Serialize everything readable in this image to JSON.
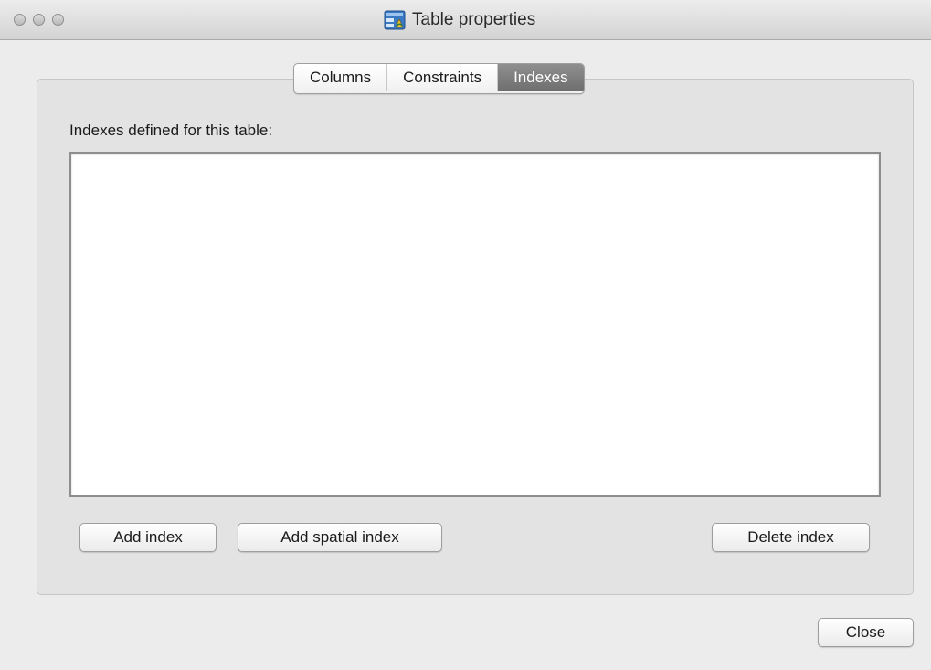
{
  "window": {
    "title": "Table properties",
    "title_icon": "database-table-icon"
  },
  "tabs": [
    {
      "label": "Columns",
      "active": false
    },
    {
      "label": "Constraints",
      "active": false
    },
    {
      "label": "Indexes",
      "active": true
    }
  ],
  "indexes_panel": {
    "label": "Indexes defined for this table:",
    "items": []
  },
  "buttons": {
    "add_index": "Add index",
    "add_spatial_index": "Add spatial index",
    "delete_index": "Delete index",
    "close": "Close"
  }
}
